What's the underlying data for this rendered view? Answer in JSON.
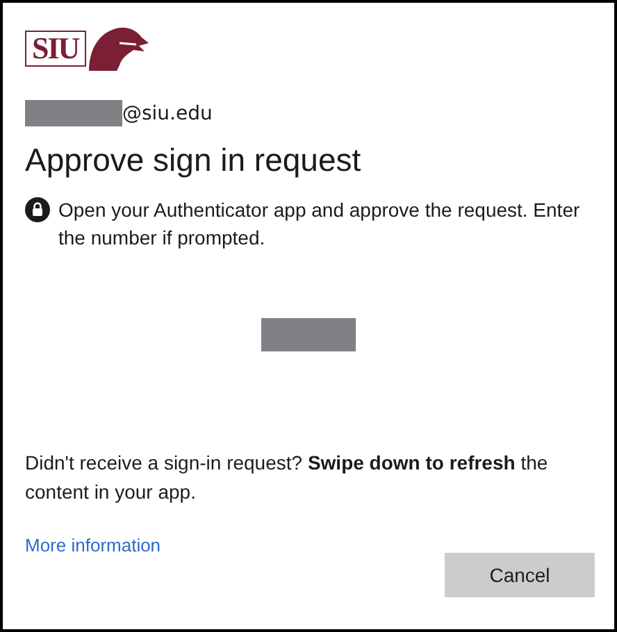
{
  "logo": {
    "text": "SIU"
  },
  "account": {
    "email_suffix": "@siu.edu"
  },
  "title": "Approve sign in request",
  "instruction": "Open your Authenticator app and approve the request. Enter the number if prompted.",
  "help_text": "Didn't receive a sign-in request? **Swipe down to refresh** the content in your app.",
  "link": "More information",
  "buttons": [
    {
      "label": "Cancel"
    }
  ]
}
